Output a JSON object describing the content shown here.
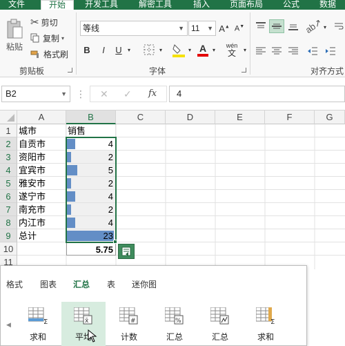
{
  "tabs": [
    "文件",
    "开始",
    "开发工具",
    "解密工具",
    "插入",
    "页面布局",
    "公式",
    "数据"
  ],
  "clipboard": {
    "paste": "粘贴",
    "cut": "剪切",
    "copy": "复制",
    "format_painter": "格式刷",
    "group_label": "剪贴板"
  },
  "font": {
    "name": "等线",
    "size": "11",
    "bold": "B",
    "italic": "I",
    "underline": "U",
    "phonetic": "wén",
    "group_label": "字体"
  },
  "alignment": {
    "group_label": "对齐方式"
  },
  "formula_bar": {
    "name_box": "B2",
    "cancel": "✕",
    "enter": "✓",
    "fx": "fx",
    "value": "4"
  },
  "columns": [
    "A",
    "B",
    "C",
    "D",
    "E",
    "F",
    "G"
  ],
  "rows": [
    {
      "n": "1",
      "a": "城市",
      "b": ""
    },
    {
      "n": "2",
      "a": "自贡市",
      "b": "4"
    },
    {
      "n": "3",
      "a": "资阳市",
      "b": "2"
    },
    {
      "n": "4",
      "a": "宜宾市",
      "b": "5"
    },
    {
      "n": "5",
      "a": "雅安市",
      "b": "2"
    },
    {
      "n": "6",
      "a": "遂宁市",
      "b": "4"
    },
    {
      "n": "7",
      "a": "南充市",
      "b": "2"
    },
    {
      "n": "8",
      "a": "内江市",
      "b": "4"
    },
    {
      "n": "9",
      "a": "总计",
      "b": "23"
    },
    {
      "n": "10",
      "a": "",
      "b": "5.75"
    },
    {
      "n": "11",
      "a": "",
      "b": ""
    }
  ],
  "header_b1": "销售",
  "databar_max": 23,
  "quick_analysis": {
    "tabs": [
      "格式",
      "图表",
      "汇总",
      "表",
      "迷你图"
    ],
    "active_tab": "汇总",
    "items": [
      "求和",
      "平均",
      "计数",
      "汇总",
      "汇总",
      "求和"
    ]
  },
  "colors": {
    "accent": "#217346",
    "databar": "#638ec6",
    "hover": "#d7ecdf"
  }
}
